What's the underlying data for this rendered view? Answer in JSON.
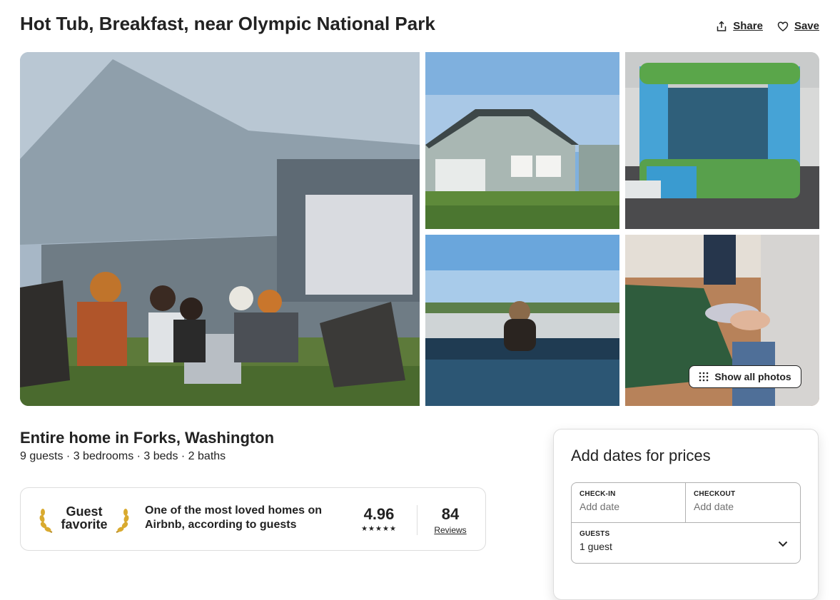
{
  "listing": {
    "title": "Hot Tub, Breakfast, near Olympic National Park",
    "share_label": "Share",
    "save_label": "Save",
    "show_all_photos_label": "Show all photos"
  },
  "overview": {
    "home_type": "Entire home in Forks, Washington",
    "facts": "9 guests · 3 bedrooms · 3 beds · 2 baths"
  },
  "guest_favorite": {
    "label_line1": "Guest",
    "label_line2": "favorite",
    "description": "One of the most loved homes on Airbnb, according to guests",
    "rating": "4.96",
    "stars": "★★★★★",
    "reviews_count": "84",
    "reviews_label": "Reviews"
  },
  "booking": {
    "title": "Add dates for prices",
    "checkin_label": "CHECK-IN",
    "checkin_value": "Add date",
    "checkout_label": "CHECKOUT",
    "checkout_value": "Add date",
    "guests_label": "GUESTS",
    "guests_value": "1 guest"
  },
  "icons": {
    "share": "share-icon",
    "save": "heart-icon",
    "grid": "grid-icon",
    "chevron": "chevron-down-icon",
    "laurel": "laurel-icon"
  }
}
